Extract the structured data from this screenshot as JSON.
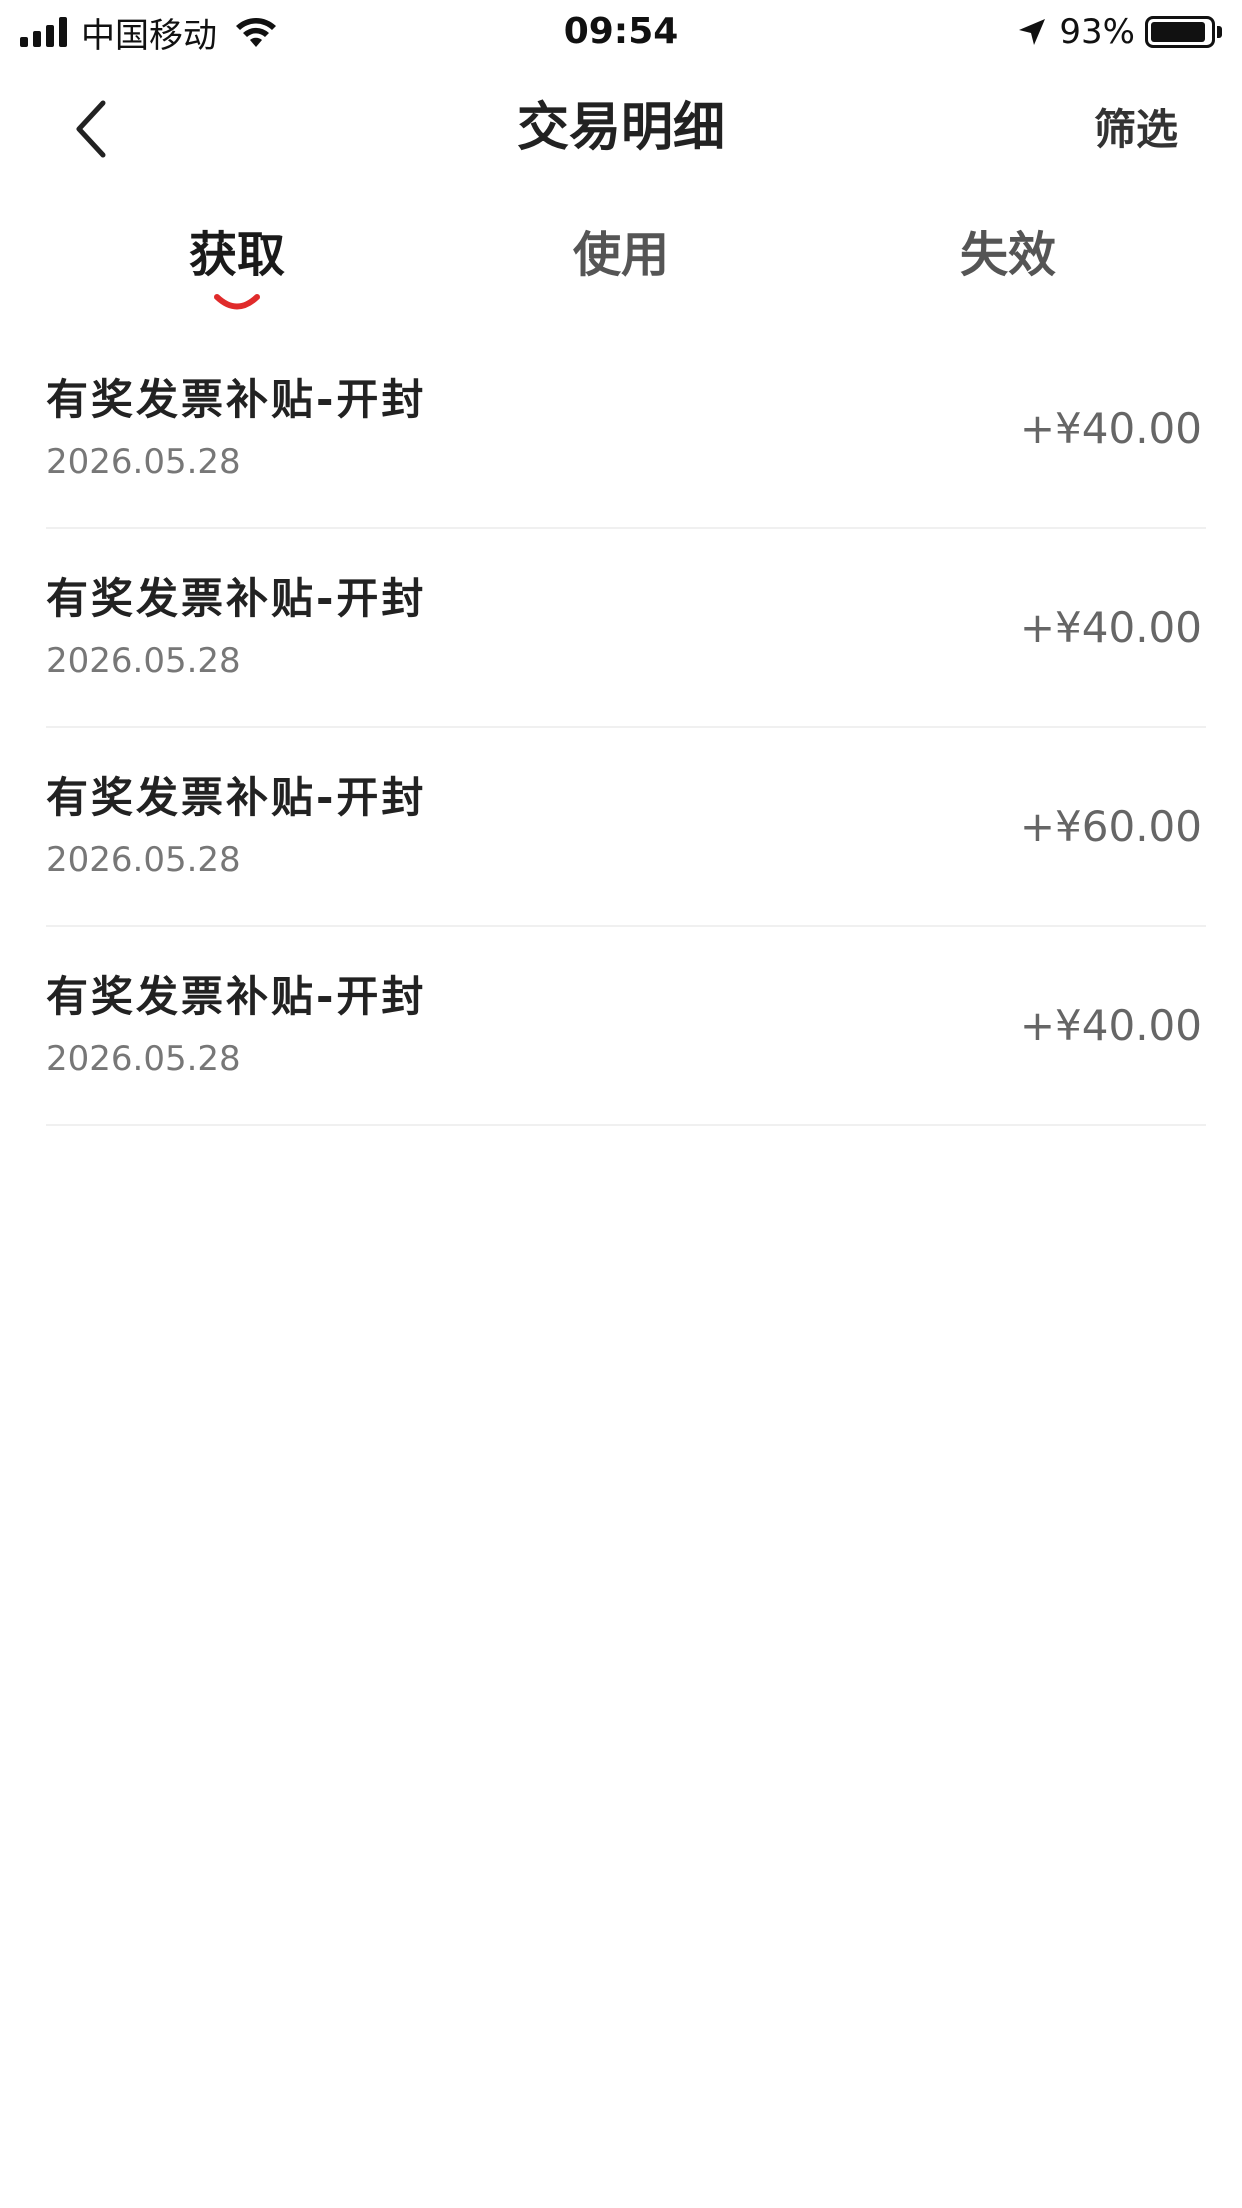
{
  "status_bar": {
    "carrier": "中国移动",
    "time": "09:54",
    "battery_percent": "93%",
    "battery_level": 0.93
  },
  "nav": {
    "title": "交易明细",
    "filter_label": "筛选",
    "back_icon": "chevron-left-icon"
  },
  "tabs": [
    {
      "label": "获取",
      "active": true
    },
    {
      "label": "使用",
      "active": false
    },
    {
      "label": "失效",
      "active": false
    }
  ],
  "accent_color": "#e02b2b",
  "transactions": [
    {
      "title": "有奖发票补贴-开封",
      "date": "2026.05.28",
      "amount": "+¥40.00"
    },
    {
      "title": "有奖发票补贴-开封",
      "date": "2026.05.28",
      "amount": "+¥40.00"
    },
    {
      "title": "有奖发票补贴-开封",
      "date": "2026.05.28",
      "amount": "+¥60.00"
    },
    {
      "title": "有奖发票补贴-开封",
      "date": "2026.05.28",
      "amount": "+¥40.00"
    }
  ]
}
